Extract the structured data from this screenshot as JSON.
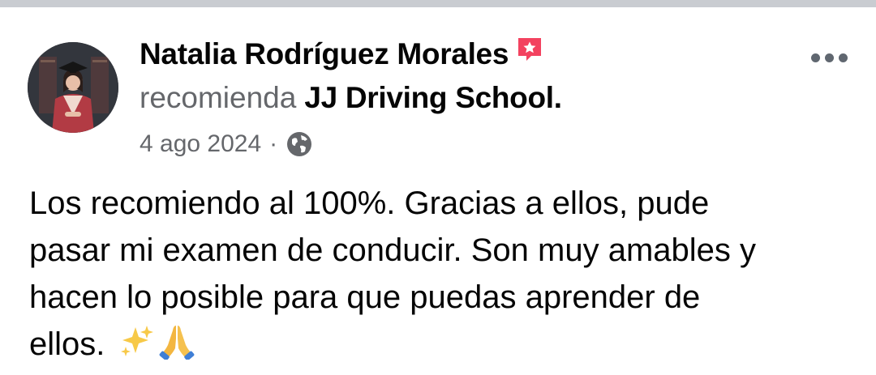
{
  "post": {
    "author_name": "Natalia Rodríguez Morales",
    "recommend_verb": "recomienda",
    "page_name": "JJ Driving School.",
    "date": "4 ago 2024",
    "separator": "·",
    "privacy_icon": "globe-icon",
    "body_lines": [
      "Los recomiendo al 100%. Gracias a ellos, pude",
      "pasar mi examen de conducir. Son muy amables y",
      "hacen lo posible para que puedas aprender de",
      "ellos."
    ],
    "emojis": [
      "sparkles",
      "folded-hands"
    ]
  },
  "icons": {
    "recommendation_badge": "recommendation-icon",
    "more": "more-options-icon"
  },
  "colors": {
    "primary_text": "#050505",
    "secondary_text": "#65676b",
    "recommendation_badge": "#f3425f",
    "divider": "#c9ccd1"
  }
}
